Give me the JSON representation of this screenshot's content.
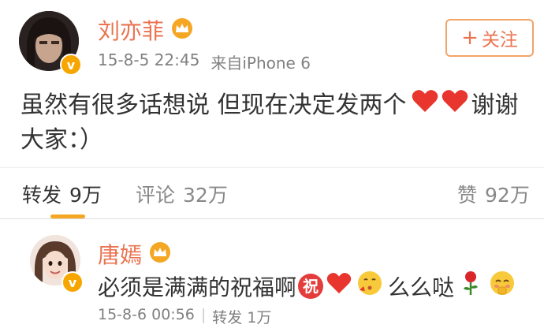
{
  "post": {
    "author": "刘亦菲",
    "meta_time": "15-8-5 22:45",
    "meta_from": "来自iPhone 6",
    "follow_label": "关注",
    "text_part1": "虽然有很多话想说 但现在决定发两个",
    "text_part2": "谢谢",
    "text_line2": "大家：）"
  },
  "actions": {
    "repost_label": "转发",
    "repost_count": "9万",
    "comment_label": "评论",
    "comment_count": "32万",
    "like_label": "赞",
    "like_count": "92万"
  },
  "comment": {
    "author": "唐嫣",
    "text_part1": "必须是满满的祝福啊",
    "zhu": "祝",
    "text_part2": "么么哒",
    "meta_time": "15-8-6 00:56",
    "meta_sep": "|",
    "meta_repost": "转发 1万"
  },
  "colors": {
    "accent": "#eb7350",
    "heart": "#e8352e",
    "badge": "#f7a600"
  },
  "icons": [
    "crown-icon",
    "verified-badge-icon",
    "plus-icon",
    "heart-icon",
    "kiss-emoji-icon",
    "rose-icon",
    "blush-emoji-icon"
  ]
}
